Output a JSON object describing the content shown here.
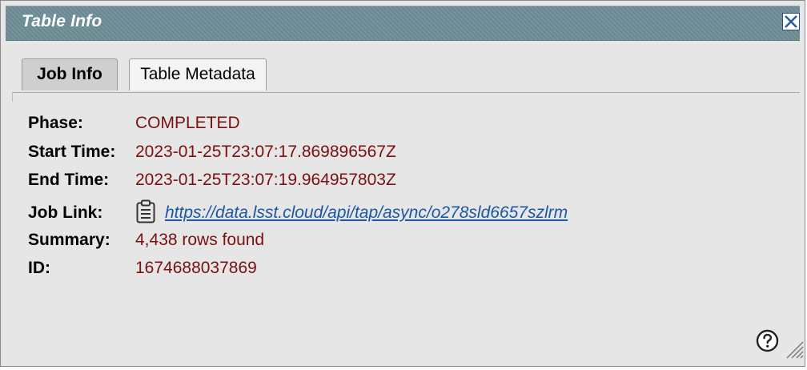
{
  "dialog": {
    "title": "Table Info",
    "close_icon": "close-x-icon"
  },
  "tabs": [
    {
      "label": "Job Info",
      "active": true
    },
    {
      "label": "Table Metadata",
      "active": false
    }
  ],
  "job_info": {
    "phase_label": "Phase:",
    "phase_value": "COMPLETED",
    "start_label": "Start Time:",
    "start_value": "2023-01-25T23:07:17.869896567Z",
    "end_label": "End Time:",
    "end_value": "2023-01-25T23:07:19.964957803Z",
    "link_label": "Job Link:",
    "link_value": "https://data.lsst.cloud/api/tap/async/o278sld6657szlrm",
    "link_icon": "clipboard-icon",
    "summary_label": "Summary:",
    "summary_value": "4,438 rows found",
    "id_label": "ID:",
    "id_value": "1674688037869"
  },
  "footer": {
    "help_icon": "help-question-icon",
    "resize_icon": "resize-grip-icon"
  },
  "colors": {
    "titlebar": "#6e8d95",
    "value_text": "#7a1010",
    "link_text": "#1c56a5",
    "panel_bg": "#e6e6e6"
  }
}
